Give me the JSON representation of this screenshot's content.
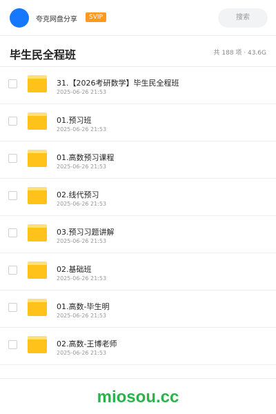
{
  "topbar": {
    "avatar_color": "#1677ff",
    "user_name": "夸克网盘分享",
    "vip_badge": "SVIP",
    "search_placeholder": "搜索"
  },
  "header": {
    "title": "毕生民全程班",
    "meta": "共 188 项 · 43.6G"
  },
  "files": [
    {
      "name": "31.【2026考研数学】毕生民全程班",
      "date": "2025-06-26 21:53"
    },
    {
      "name": "01.预习班",
      "date": "2025-06-26 21:53"
    },
    {
      "name": "01.高数预习课程",
      "date": "2025-06-26 21:53"
    },
    {
      "name": "02.线代预习",
      "date": "2025-06-26 21:53"
    },
    {
      "name": "03.预习习题讲解",
      "date": "2025-06-26 21:53"
    },
    {
      "name": "02.基础班",
      "date": "2025-06-26 21:53"
    },
    {
      "name": "01.高数-毕生明",
      "date": "2025-06-26 21:53"
    },
    {
      "name": "02.高数-王博老师",
      "date": "2025-06-26 21:53"
    }
  ],
  "watermark": "miosou.cc",
  "colors": {
    "folder": "#ffc21a",
    "vip": "#ff9a1f",
    "watermark": "#29b34a"
  }
}
